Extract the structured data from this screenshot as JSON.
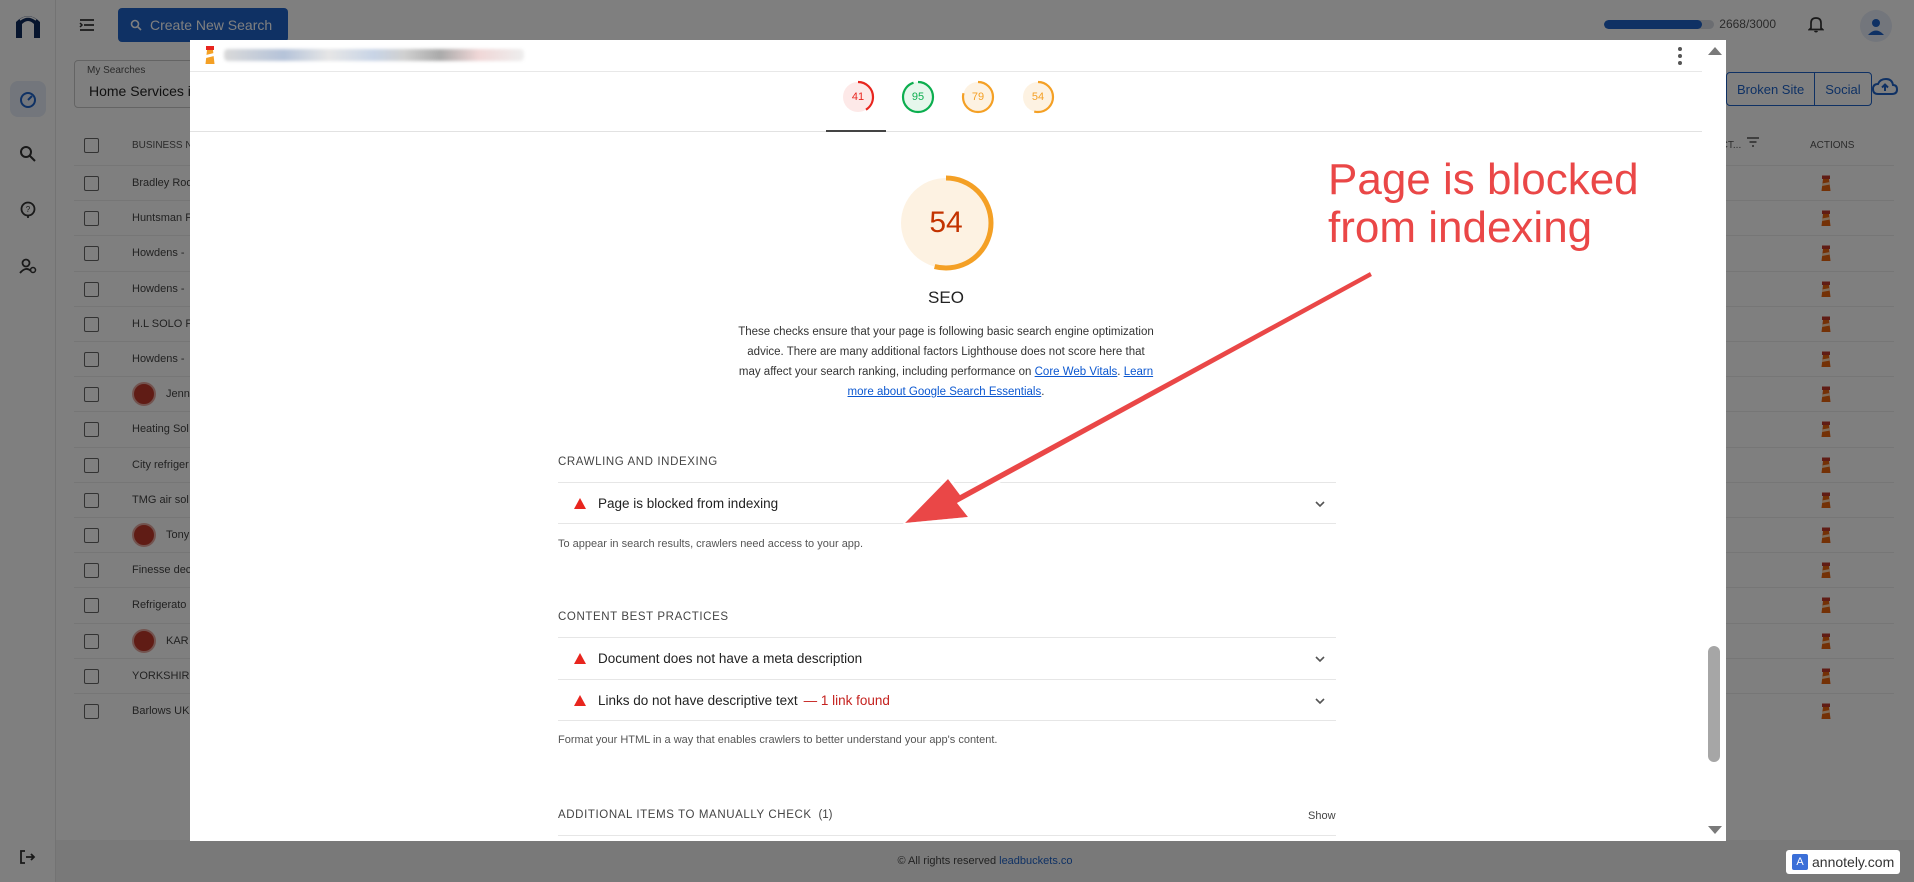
{
  "app": {
    "create_button": "Create New Search",
    "credits_text": "2668/3000",
    "credits_used": 2668,
    "credits_total": 3000,
    "my_searches_label": "My Searches",
    "my_searches_value": "Home Services in",
    "tabs": [
      "Broken Site",
      "Social"
    ],
    "table_headers": {
      "name": "BUSINESS NA",
      "cut": "ECT...",
      "actions": "ACTIONS"
    },
    "rows": [
      {
        "name": "Bradley Roo",
        "badge": false
      },
      {
        "name": "Huntsman F",
        "badge": false
      },
      {
        "name": "Howdens - ",
        "badge": false
      },
      {
        "name": "Howdens - ",
        "badge": false
      },
      {
        "name": "H.L SOLO P",
        "badge": false
      },
      {
        "name": "Howdens - ",
        "badge": false
      },
      {
        "name": "Jenn",
        "badge": true
      },
      {
        "name": "Heating Sol",
        "badge": false
      },
      {
        "name": "City refriger",
        "badge": false
      },
      {
        "name": "TMG air sol",
        "badge": false
      },
      {
        "name": "Tony",
        "badge": true
      },
      {
        "name": "Finesse dec",
        "badge": false
      },
      {
        "name": "Refrigerato",
        "badge": false
      },
      {
        "name": "KAR",
        "badge": true
      },
      {
        "name": "YORKSHIRE",
        "badge": false
      },
      {
        "name": "Barlows UK",
        "badge": false
      }
    ],
    "footer_text": "© All rights reserved ",
    "footer_link": "leadbuckets.co"
  },
  "report": {
    "scores": [
      {
        "value": "41",
        "color": "#e8251e",
        "bg": "#fde9e8",
        "fraction": 0.41
      },
      {
        "value": "95",
        "color": "#0cae4f",
        "bg": "#e6f7ec",
        "fraction": 0.95
      },
      {
        "value": "79",
        "color": "#f4a025",
        "bg": "#fdf2e2",
        "fraction": 0.79
      },
      {
        "value": "54",
        "color": "#f4a025",
        "bg": "#fdf2e2",
        "fraction": 0.54
      }
    ],
    "seo": {
      "score": "54",
      "fraction": 0.54,
      "title": "SEO",
      "desc_prefix": "These checks ensure that your page is following basic search engine optimization advice. There are many additional factors Lighthouse does not score here that may affect your search ranking, including performance on ",
      "link1": "Core Web Vitals",
      "sep": ". ",
      "link2": "Learn more about Google Search Essentials",
      "desc_suffix": "."
    },
    "sections": {
      "crawling_title": "CRAWLING AND INDEXING",
      "crawling_audit": "Page is blocked from indexing",
      "crawling_desc": "To appear in search results, crawlers need access to your app.",
      "content_title": "CONTENT BEST PRACTICES",
      "content_audit1": "Document does not have a meta description",
      "content_audit2": "Links do not have descriptive text",
      "content_audit2_extra": "— 1 link found",
      "content_desc": "Format your HTML in a way that enables crawlers to better understand your app's content.",
      "manual_title": "ADDITIONAL ITEMS TO MANUALLY CHECK",
      "manual_count": "(1)",
      "manual_show": "Show"
    }
  },
  "annotation": {
    "line1": "Page is blocked",
    "line2": "from indexing",
    "color": "#ea4747"
  },
  "watermark": "annotely.com"
}
